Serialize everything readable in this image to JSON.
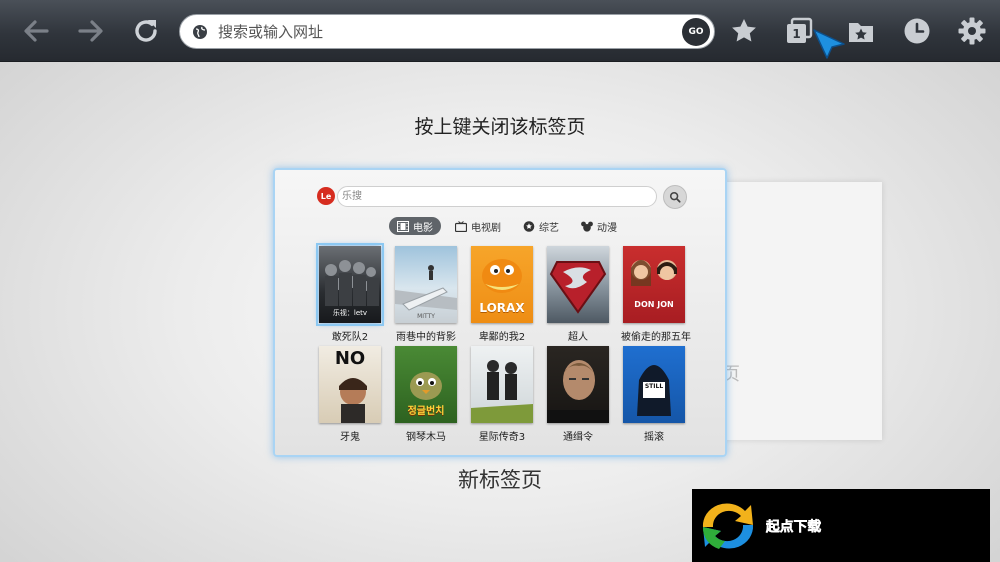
{
  "toolbar": {
    "address_placeholder": "搜索或输入网址",
    "go_label": "GO"
  },
  "hint": "按上键关闭该标签页",
  "new_tab_label": "新标签页",
  "card": {
    "logo_text": "Le",
    "search_placeholder": "乐搜",
    "categories": [
      {
        "label": "电影",
        "icon": "film-icon",
        "active": true
      },
      {
        "label": "电视剧",
        "icon": "tv-icon",
        "active": false
      },
      {
        "label": "综艺",
        "icon": "star-circle-icon",
        "active": false
      },
      {
        "label": "动漫",
        "icon": "mouse-ears-icon",
        "active": false
      }
    ],
    "movies": [
      {
        "title": "敢死队2",
        "poster_text": "乐视：letv"
      },
      {
        "title": "雨巷中的背影",
        "poster_text": "MITTY"
      },
      {
        "title": "卑鄙的我2",
        "poster_text": "LORAX"
      },
      {
        "title": "超人",
        "poster_text": ""
      },
      {
        "title": "被偷走的那五年",
        "poster_text": "DON JON"
      },
      {
        "title": "牙鬼",
        "poster_text": "NO"
      },
      {
        "title": "钢琴木马",
        "poster_text": "정글번치"
      },
      {
        "title": "星际传奇3",
        "poster_text": ""
      },
      {
        "title": "通缉令",
        "poster_text": ""
      },
      {
        "title": "摇滚",
        "poster_text": "STILL"
      }
    ]
  },
  "watermark": "起点下载",
  "colors": {
    "toolbar": "#30353c",
    "card_border": "#a9d4f4",
    "active_category": "#5f6469",
    "cursor": "#1e90e0"
  }
}
